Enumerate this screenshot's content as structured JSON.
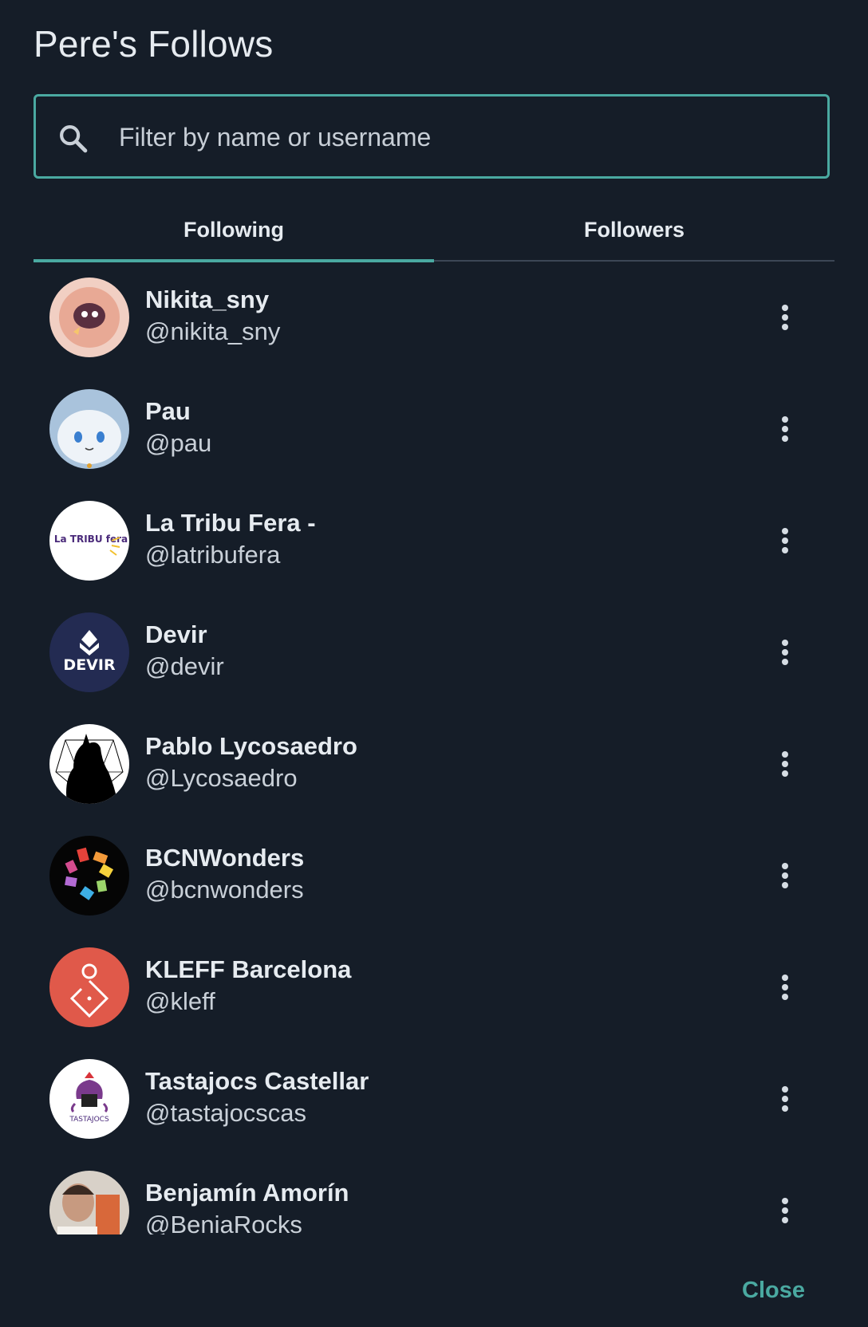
{
  "dialog": {
    "title": "Pere's Follows",
    "close_label": "Close"
  },
  "search": {
    "placeholder": "Filter by name or username",
    "value": ""
  },
  "tabs": [
    {
      "label": "Following",
      "active": true
    },
    {
      "label": "Followers",
      "active": false
    }
  ],
  "users": [
    {
      "name": "Nikita_sny",
      "handle": "@nikita_sny"
    },
    {
      "name": "Pau",
      "handle": "@pau"
    },
    {
      "name": "La Tribu Fera -",
      "handle": "@latribufera"
    },
    {
      "name": "Devir",
      "handle": "@devir"
    },
    {
      "name": "Pablo Lycosaedro",
      "handle": "@Lycosaedro"
    },
    {
      "name": "BCNWonders",
      "handle": "@bcnwonders"
    },
    {
      "name": "KLEFF Barcelona",
      "handle": "@kleff"
    },
    {
      "name": "Tastajocs Castellar",
      "handle": "@tastajocscas"
    },
    {
      "name": "Benjamín Amorín",
      "handle": "@BeniaRocks"
    }
  ],
  "avatar_logo_text": {
    "latribufera": "La TRIBU fera",
    "devir": "DEVIR",
    "tastajocs": "TASTAJOCS"
  },
  "colors": {
    "background": "#151d28",
    "accent": "#4aa9a1",
    "text": "#e6ebf0"
  },
  "icons": {
    "search": "search-icon",
    "more": "more-vertical-icon"
  }
}
